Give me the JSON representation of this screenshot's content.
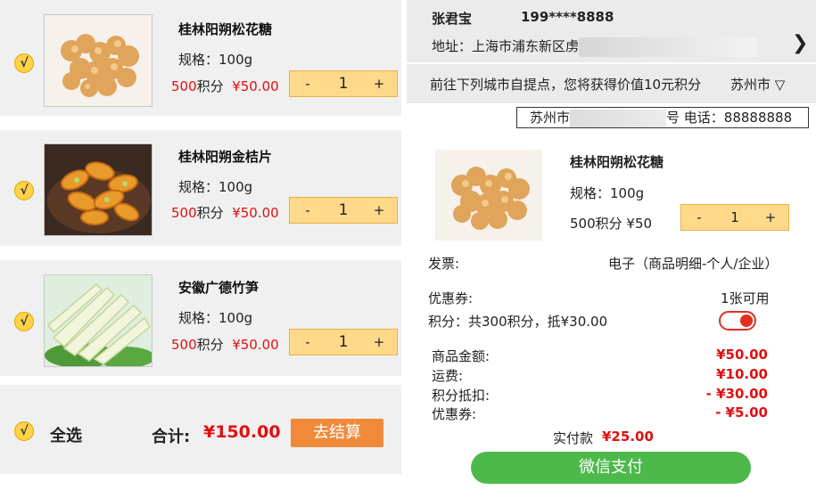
{
  "cart": {
    "items": [
      {
        "title": "桂林阳朔松花糖",
        "spec": "规格：100g",
        "points": "500",
        "points_unit": "积分",
        "price": "¥50.00",
        "qty": "1",
        "minus": "-",
        "plus": "+",
        "check": "√"
      },
      {
        "title": "桂林阳朔金桔片",
        "spec": "规格：100g",
        "points": "500",
        "points_unit": "积分",
        "price": "¥50.00",
        "qty": "1",
        "minus": "-",
        "plus": "+",
        "check": "√"
      },
      {
        "title": "安徽广德竹笋",
        "spec": "规格：100g",
        "points": "500",
        "points_unit": "积分",
        "price": "¥50.00",
        "qty": "1",
        "minus": "-",
        "plus": "+",
        "check": "√"
      }
    ],
    "select_all_check": "√",
    "select_all_label": "全选",
    "total_label": "合计:",
    "total_value": "¥150.00",
    "checkout_label": "去结算"
  },
  "order": {
    "recipient_name": "张君宝",
    "recipient_phone": "199****8888",
    "address_prefix": "地址：上海市浦东新区虏",
    "chevron": "❯",
    "pickup_text": "前往下列城市自提点，您将获得价值10元积分",
    "pickup_city": "苏州市 ▽",
    "store_prefix": "苏州市",
    "store_suffix": "号 电话：88888888",
    "item": {
      "title": "桂林阳朔松花糖",
      "spec": "规格：100g",
      "price": "500积分 ¥50",
      "qty": "1",
      "minus": "-",
      "plus": "+"
    },
    "invoice_label": "发票:",
    "invoice_value": "电子（商品明细-个人/企业）",
    "coupon_label": "优惠券:",
    "coupon_value": "1张可用",
    "points_text": "积分：共300积分，抵¥30.00",
    "points_toggle_on": true,
    "summary": [
      {
        "label": "商品金额:",
        "value": "¥50.00"
      },
      {
        "label": "运费:",
        "value": "¥10.00"
      },
      {
        "label": "积分抵扣:",
        "value": "- ¥30.00"
      },
      {
        "label": "优惠券:",
        "value": "- ¥5.00"
      }
    ],
    "paid_label": "实付款",
    "paid_value": "¥25.00",
    "pay_button": "微信支付"
  },
  "colors": {
    "accent": "#ffd98a",
    "price_red": "#e01010",
    "checkout": "#f08a3a",
    "pay_green": "#4cb94a"
  }
}
